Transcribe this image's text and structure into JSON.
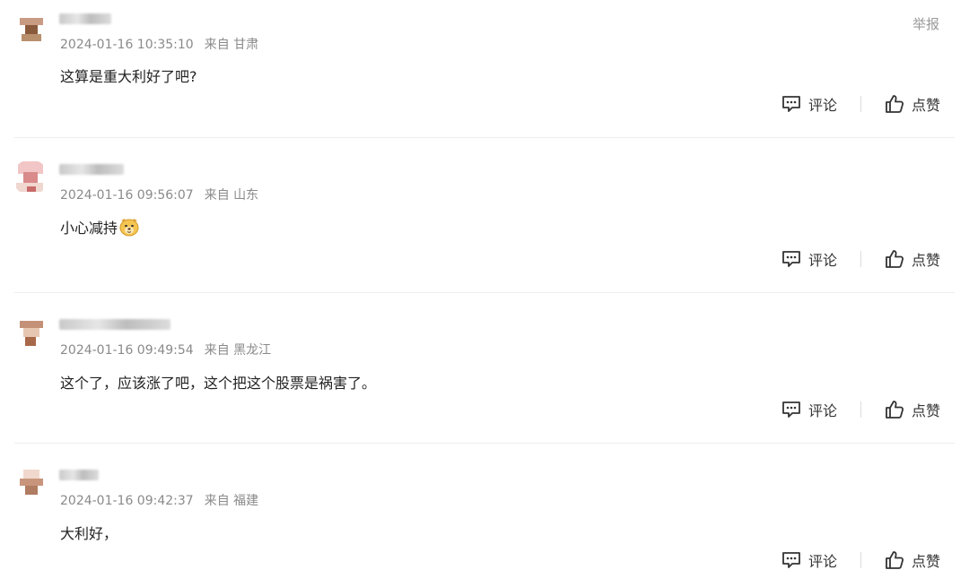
{
  "report_label": "举报",
  "actions": {
    "comment_label": "评论",
    "like_label": "点赞",
    "comment_icon": "comment-bubble-icon",
    "like_icon": "thumbs-up-icon"
  },
  "comments": [
    {
      "time": "2024-01-16 10:35:10",
      "location": "来自 甘肃",
      "text": "这算是重大利好了吧?"
    },
    {
      "time": "2024-01-16 09:56:07",
      "location": "来自 山东",
      "text": "小心减持",
      "emoji": "dog-face-emoji"
    },
    {
      "time": "2024-01-16 09:49:54",
      "location": "来自 黑龙江",
      "text": "这个了，应该涨了吧，这个把这个股票是祸害了。"
    },
    {
      "time": "2024-01-16 09:42:37",
      "location": "来自 福建",
      "text": "大利好，"
    }
  ]
}
